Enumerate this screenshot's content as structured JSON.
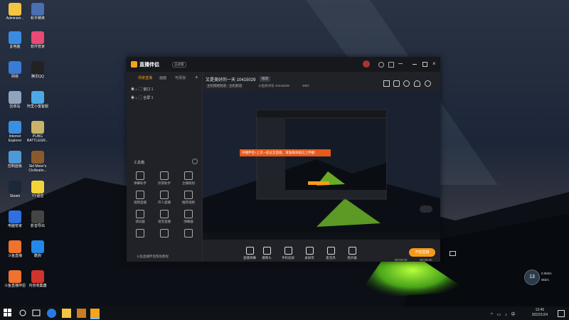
{
  "desktop": {
    "icons": [
      {
        "label": "Administr...",
        "color": "#f3c542"
      },
      {
        "label": "和平精英",
        "color": "#4a6fb2"
      },
      {
        "label": "此电脑",
        "color": "#3c8be0"
      },
      {
        "label": "软件管家",
        "color": "#e84a75"
      },
      {
        "label": "网络",
        "color": "#3a7bd5"
      },
      {
        "label": "腾讯QQ",
        "color": "#222"
      },
      {
        "label": "回收站",
        "color": "#8fa5bd"
      },
      {
        "label": "阿里小蜜客服",
        "color": "#4ba9e6"
      },
      {
        "label": "Internet\nExplorer",
        "color": "#3a8fe0"
      },
      {
        "label": "PUBG\nBATTLEGR...",
        "color": "#c9b36a"
      },
      {
        "label": "控制面板",
        "color": "#4f9ad6"
      },
      {
        "label": "Sid Meier's\nCivilizatio...",
        "color": "#8a5a2d"
      },
      {
        "label": "Steam",
        "color": "#1b2838"
      },
      {
        "label": "YY语音",
        "color": "#f2d33a"
      },
      {
        "label": "电脑管家",
        "color": "#2f6fe0"
      },
      {
        "label": "影音导出",
        "color": "#444"
      },
      {
        "label": "斗鱼直播",
        "color": "#f0722e"
      },
      {
        "label": "酷狗",
        "color": "#2388e6"
      },
      {
        "label": "斗鱼直播伴侣",
        "color": "#f0722e"
      },
      {
        "label": "内容收集器",
        "color": "#d0342c"
      }
    ]
  },
  "window": {
    "title": "直播伴侣",
    "badge": "正式版",
    "left_tabs": [
      "场景直播",
      "画面",
      "可添加"
    ],
    "scenes": [
      "窗口 1",
      "全屏 1"
    ],
    "tools_header": "工具箱",
    "tools": [
      "弹幕助手",
      "房管助手",
      "主播规划",
      "视频直播",
      "开人直播",
      "推荐视频",
      "调试器",
      "语音直播",
      "弹幕器",
      "",
      "",
      ""
    ],
    "bottom_tip": "斗鱼直播伴侣帮助教程",
    "stream_title": "又是美好的一天 10415029",
    "stream_tag": "修改",
    "stream_meta": [
      "主机网络频道 · 主机频道",
      "斗鱼房间号 10415029",
      "3057"
    ],
    "notice": "开播伴侣+上次一起过又直接，请准确添加已上传播！",
    "controls": [
      "直播弹幕",
      "摄像头",
      "手机投屏",
      "录屏等",
      "麦克风",
      "扬声器"
    ],
    "go_live": "开始直播",
    "time_left": "00:00:02",
    "time_right": "00:00:00",
    "live_counter": "13",
    "net_up": "0.0kb/s",
    "net_down": "0kb/s"
  },
  "taskbar": {
    "time": "13:45",
    "date": "2022/1/24"
  }
}
